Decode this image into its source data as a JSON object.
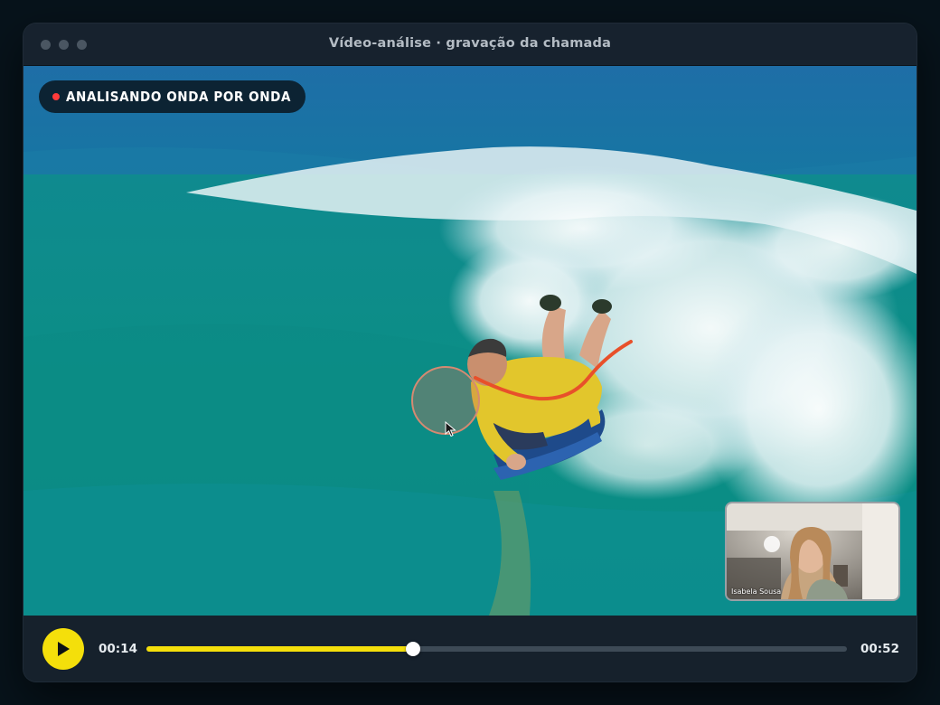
{
  "window": {
    "title": "Vídeo-análise · gravação da chamada"
  },
  "badge": {
    "label": "ANALISANDO ONDA POR ONDA",
    "rec_color": "#ff3b3b"
  },
  "pip": {
    "name": "Isabela Sousa"
  },
  "player": {
    "current_time": "00:14",
    "duration": "00:52",
    "progress_percent": 38,
    "accent_color": "#f4df0b",
    "play_icon": "play-icon"
  },
  "annotation": {
    "pen_color": "#e8502a",
    "cursor_icon": "cursor-icon"
  }
}
